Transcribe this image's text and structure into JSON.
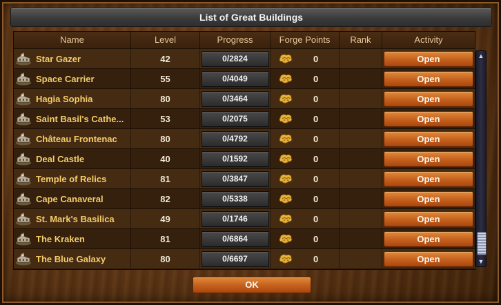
{
  "window": {
    "title": "List of Great Buildings"
  },
  "columns": {
    "name": "Name",
    "level": "Level",
    "progress": "Progress",
    "forge_points": "Forge Points",
    "rank": "Rank",
    "activity": "Activity"
  },
  "rows": [
    {
      "name": "Star Gazer",
      "level": "42",
      "progress": "0/2824",
      "forge_points": "0",
      "rank": "",
      "action": "Open",
      "icon": "building-icon"
    },
    {
      "name": "Space Carrier",
      "level": "55",
      "progress": "0/4049",
      "forge_points": "0",
      "rank": "",
      "action": "Open",
      "icon": "building-icon"
    },
    {
      "name": "Hagia Sophia",
      "level": "80",
      "progress": "0/3464",
      "forge_points": "0",
      "rank": "",
      "action": "Open",
      "icon": "building-icon"
    },
    {
      "name": "Saint Basil's Cathe...",
      "level": "53",
      "progress": "0/2075",
      "forge_points": "0",
      "rank": "",
      "action": "Open",
      "icon": "building-icon"
    },
    {
      "name": "Château Frontenac",
      "level": "80",
      "progress": "0/4792",
      "forge_points": "0",
      "rank": "",
      "action": "Open",
      "icon": "building-icon"
    },
    {
      "name": "Deal Castle",
      "level": "40",
      "progress": "0/1592",
      "forge_points": "0",
      "rank": "",
      "action": "Open",
      "icon": "building-icon"
    },
    {
      "name": "Temple of Relics",
      "level": "81",
      "progress": "0/3847",
      "forge_points": "0",
      "rank": "",
      "action": "Open",
      "icon": "building-icon"
    },
    {
      "name": "Cape Canaveral",
      "level": "82",
      "progress": "0/5338",
      "forge_points": "0",
      "rank": "",
      "action": "Open",
      "icon": "building-icon"
    },
    {
      "name": "St. Mark's Basilica",
      "level": "49",
      "progress": "0/1746",
      "forge_points": "0",
      "rank": "",
      "action": "Open",
      "icon": "building-icon"
    },
    {
      "name": "The Kraken",
      "level": "81",
      "progress": "0/6864",
      "forge_points": "0",
      "rank": "",
      "action": "Open",
      "icon": "building-icon"
    },
    {
      "name": "The Blue Galaxy",
      "level": "80",
      "progress": "0/6697",
      "forge_points": "0",
      "rank": "",
      "action": "Open",
      "icon": "building-icon"
    }
  ],
  "footer": {
    "ok_label": "OK"
  },
  "colors": {
    "accent_button": "#c45f1c",
    "building_name": "#f4cd6a",
    "title_bar": "#3b3b3b"
  }
}
